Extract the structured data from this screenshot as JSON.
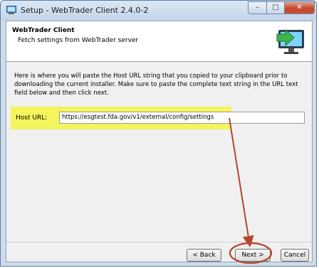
{
  "window": {
    "title": "Setup - WebTrader Client 2.4.0-2",
    "controls": {
      "minimize": "–",
      "maximize": "□",
      "close": "✕"
    }
  },
  "header": {
    "title": "WebTrader Client",
    "subtitle": "Fetch settings from WebTrader server",
    "icon": "monitor-download-icon"
  },
  "instructions": "Here is where you will paste the Host URL string that you copied to your clipboard prior to downloading the current installer. Make sure to paste the complete text string in the URL text field below and then click next.",
  "host_url": {
    "label": "Host URL:",
    "value": "https://esgtest.fda.gov/v1/external/config/settings"
  },
  "buttons": {
    "back": "< Back",
    "next": "Next >",
    "cancel": "Cancel"
  },
  "colors": {
    "highlight": "#f4f45c",
    "annotation": "#b5442a",
    "accent_green": "#3cb44b"
  }
}
